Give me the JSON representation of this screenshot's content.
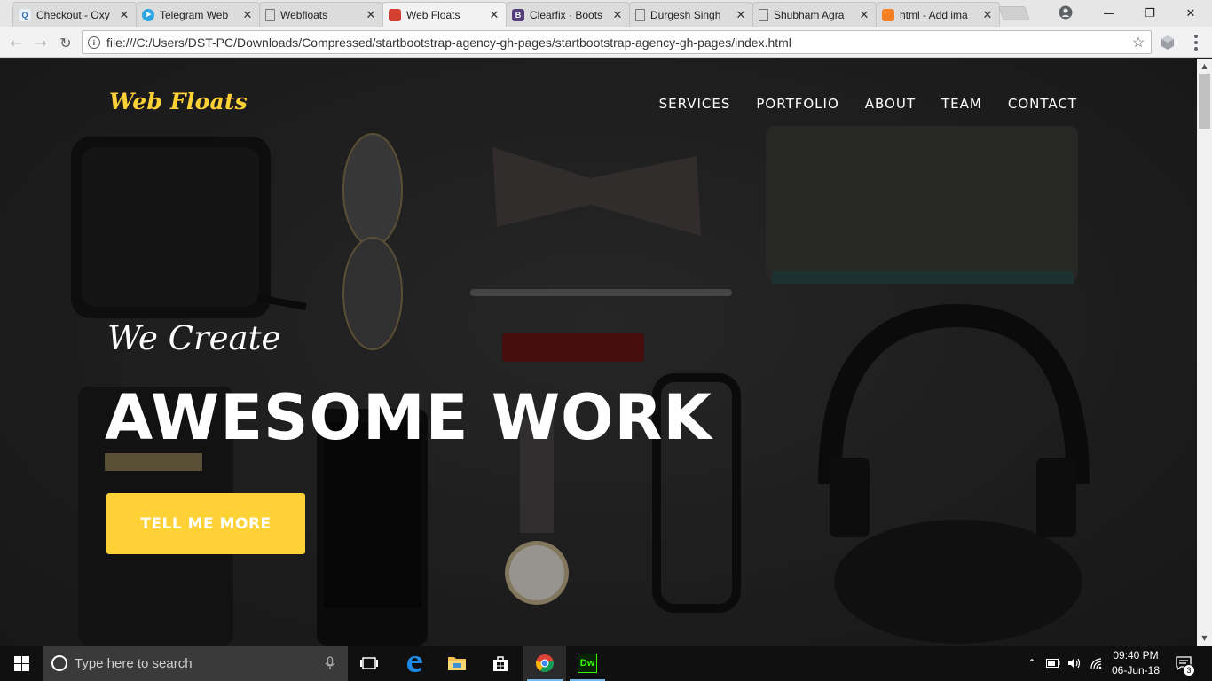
{
  "browser": {
    "tabs": [
      {
        "title": "Checkout - Oxy",
        "favicon_color": "#e8f1fb",
        "favicon_glyph": "Q",
        "favicon_text_color": "#2d6fb5"
      },
      {
        "title": "Telegram Web",
        "favicon_color": "#2ca5e0",
        "favicon_glyph": "➤",
        "favicon_text_color": "#ffffff"
      },
      {
        "title": "Webfloats",
        "favicon_color": "",
        "favicon_glyph": "",
        "favicon_text_color": "#777"
      },
      {
        "title": "Web Floats",
        "favicon_color": "#d23f2f",
        "favicon_glyph": "",
        "favicon_text_color": "#ffffff"
      },
      {
        "title": "Clearfix · Boots",
        "favicon_color": "#563d7c",
        "favicon_glyph": "B",
        "favicon_text_color": "#ffffff"
      },
      {
        "title": "Durgesh Singh",
        "favicon_color": "",
        "favicon_glyph": "",
        "favicon_text_color": "#777"
      },
      {
        "title": "Shubham Agra",
        "favicon_color": "",
        "favicon_glyph": "",
        "favicon_text_color": "#777"
      },
      {
        "title": "html - Add ima",
        "favicon_color": "#f48024",
        "favicon_glyph": "",
        "favicon_text_color": "#ffffff"
      }
    ],
    "active_tab_index": 3,
    "url": "file:///C:/Users/DST-PC/Downloads/Compressed/startbootstrap-agency-gh-pages/startbootstrap-agency-gh-pages/index.html"
  },
  "page": {
    "brand": "Web Floats",
    "nav": [
      "SERVICES",
      "PORTFOLIO",
      "ABOUT",
      "TEAM",
      "CONTACT"
    ],
    "hero": {
      "lead_in": "We Create",
      "heading": "AWESOME WORK",
      "cta": "TELL ME MORE"
    },
    "accent_color": "#fed136"
  },
  "taskbar": {
    "search_placeholder": "Type here to search",
    "time": "09:40 PM",
    "date": "06-Jun-18",
    "notifications": "3",
    "apps": [
      "task-view",
      "edge",
      "file-explorer",
      "store",
      "chrome",
      "dreamweaver"
    ],
    "dreamweaver_label": "Dw"
  }
}
